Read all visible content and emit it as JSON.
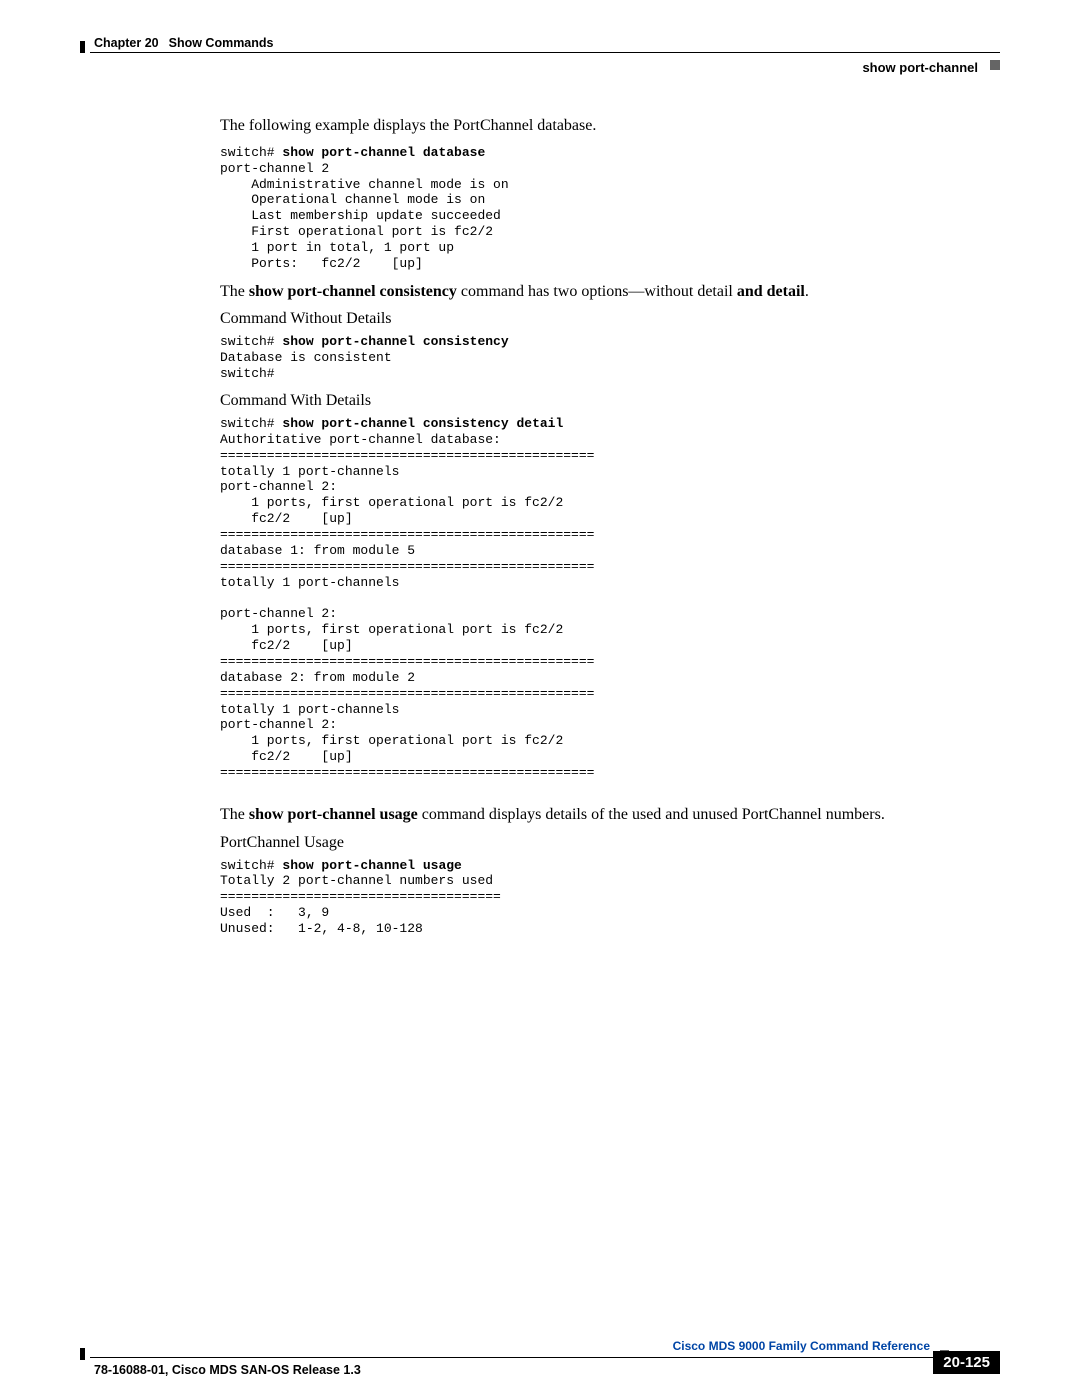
{
  "header": {
    "chapter_prefix": "Chapter 20",
    "chapter_title": "Show Commands",
    "command_name": "show port-channel"
  },
  "content": {
    "para1": "The following example displays the PortChannel database.",
    "cli1_prompt": "switch# ",
    "cli1_cmd": "show port-channel database",
    "cli1_body": "port-channel 2\n    Administrative channel mode is on\n    Operational channel mode is on\n    Last membership update succeeded\n    First operational port is fc2/2\n    1 port in total, 1 port up\n    Ports:   fc2/2    [up]",
    "para2_pre": "The ",
    "para2_cmd": "show port-channel consistency",
    "para2_mid": " command has two options—without detail ",
    "para2_bold2": "and detail",
    "para2_end": ".",
    "subhead1": "Command Without Details",
    "cli2_prompt": "switch# ",
    "cli2_cmd": "show port-channel consistency",
    "cli2_body": "Database is consistent\nswitch#",
    "subhead2": "Command With Details",
    "cli3_prompt": "switch# ",
    "cli3_cmd": "show port-channel consistency detail",
    "cli3_body": "Authoritative port-channel database:\n================================================\ntotally 1 port-channels\nport-channel 2:\n    1 ports, first operational port is fc2/2\n    fc2/2    [up]\n================================================\ndatabase 1: from module 5\n================================================\ntotally 1 port-channels\n\nport-channel 2:\n    1 ports, first operational port is fc2/2\n    fc2/2    [up]\n================================================\ndatabase 2: from module 2\n================================================\ntotally 1 port-channels\nport-channel 2:\n    1 ports, first operational port is fc2/2\n    fc2/2    [up]\n================================================",
    "para3_pre": "The ",
    "para3_cmd": "show port-channel usage",
    "para3_end": " command displays details of the used and unused PortChannel numbers.",
    "subhead3": "PortChannel Usage",
    "cli4_prompt": "switch# ",
    "cli4_cmd": "show port-channel usage",
    "cli4_body": "Totally 2 port-channel numbers used\n====================================\nUsed  :   3, 9\nUnused:   1-2, 4-8, 10-128"
  },
  "footer": {
    "reference_title": "Cisco MDS 9000 Family Command Reference",
    "doc_id": "78-16088-01, Cisco MDS SAN-OS Release 1.3",
    "page_number": "20-125"
  }
}
